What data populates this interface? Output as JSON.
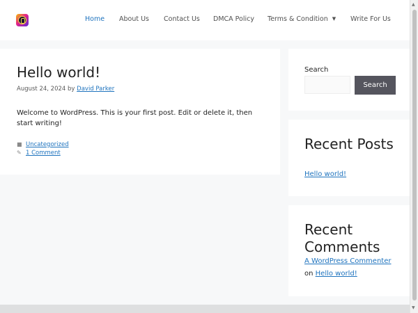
{
  "nav": {
    "items": [
      {
        "label": "Home"
      },
      {
        "label": "About Us"
      },
      {
        "label": "Contact Us"
      },
      {
        "label": "DMCA Policy"
      },
      {
        "label": "Terms & Condition"
      },
      {
        "label": "Write For Us"
      }
    ],
    "active": "Home"
  },
  "post": {
    "title": "Hello world!",
    "date": "August 24, 2024",
    "by": "by",
    "author": "David Parker",
    "body": "Welcome to WordPress. This is your first post. Edit or delete it, then start writing!",
    "category": "Uncategorized",
    "comments": "1 Comment"
  },
  "sidebar": {
    "search_label": "Search",
    "search_button": "Search",
    "recent_posts_title": "Recent Posts",
    "recent_posts": [
      "Hello world!"
    ],
    "recent_comments_title": "Recent Comments",
    "comment_author": "A WordPress Commenter",
    "comment_on": "on",
    "comment_post": "Hello world!"
  },
  "colors": {
    "accent": "#1e73be",
    "button": "#55555e",
    "background": "#f7f8f9"
  },
  "icons": [
    "logo-icon",
    "chevron-down-icon",
    "folder-icon",
    "comment-icon"
  ]
}
